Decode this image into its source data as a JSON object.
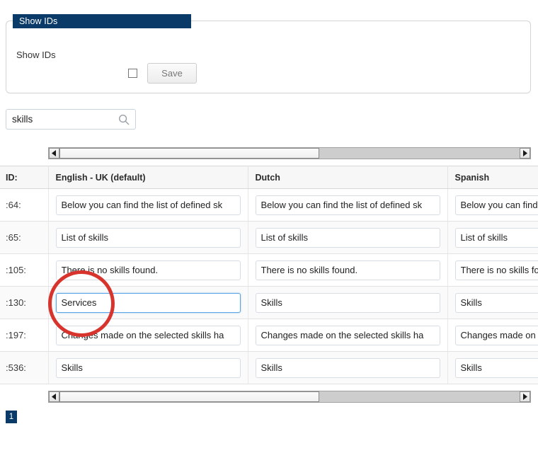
{
  "panel": {
    "legend": "Show IDs",
    "field_label": "Show IDs",
    "checkbox_checked": false,
    "save_label": "Save"
  },
  "search": {
    "value": "skills",
    "placeholder": "",
    "icon": "search-icon"
  },
  "scrollbars": {
    "left_arrow": "◀",
    "right_arrow": "▶",
    "thumb_fraction": 0.565
  },
  "table": {
    "columns": [
      "ID:",
      "English - UK (default)",
      "Dutch",
      "Spanish"
    ],
    "rows": [
      {
        "id": ":64:",
        "english": "Below you can find the list of defined sk",
        "dutch": "Below you can find the list of defined sk",
        "spanish": "Below you can find the list of defined sk",
        "focused": false
      },
      {
        "id": ":65:",
        "english": "List of skills",
        "dutch": "List of skills",
        "spanish": "List of skills",
        "focused": false
      },
      {
        "id": ":105:",
        "english": "There is no skills found.",
        "dutch": "There is no skills found.",
        "spanish": "There is no skills found.",
        "focused": false
      },
      {
        "id": ":130:",
        "english": "Services",
        "dutch": "Skills",
        "spanish": "Skills",
        "focused": true
      },
      {
        "id": ":197:",
        "english": "Changes made on the selected skills ha",
        "dutch": "Changes made on the selected skills ha",
        "spanish": "Changes made on the selected skills ha",
        "focused": false
      },
      {
        "id": ":536:",
        "english": "Skills",
        "dutch": "Skills",
        "spanish": "Skills",
        "focused": false
      }
    ]
  },
  "annotation": {
    "shape": "circle",
    "color": "#d8342e",
    "target": "english-input-row-130"
  },
  "pagination": {
    "pages": [
      "1"
    ],
    "active": "1"
  },
  "colors": {
    "navy": "#0a3a68",
    "annotation_red": "#d8342e",
    "focus_blue": "#56a5e8"
  }
}
